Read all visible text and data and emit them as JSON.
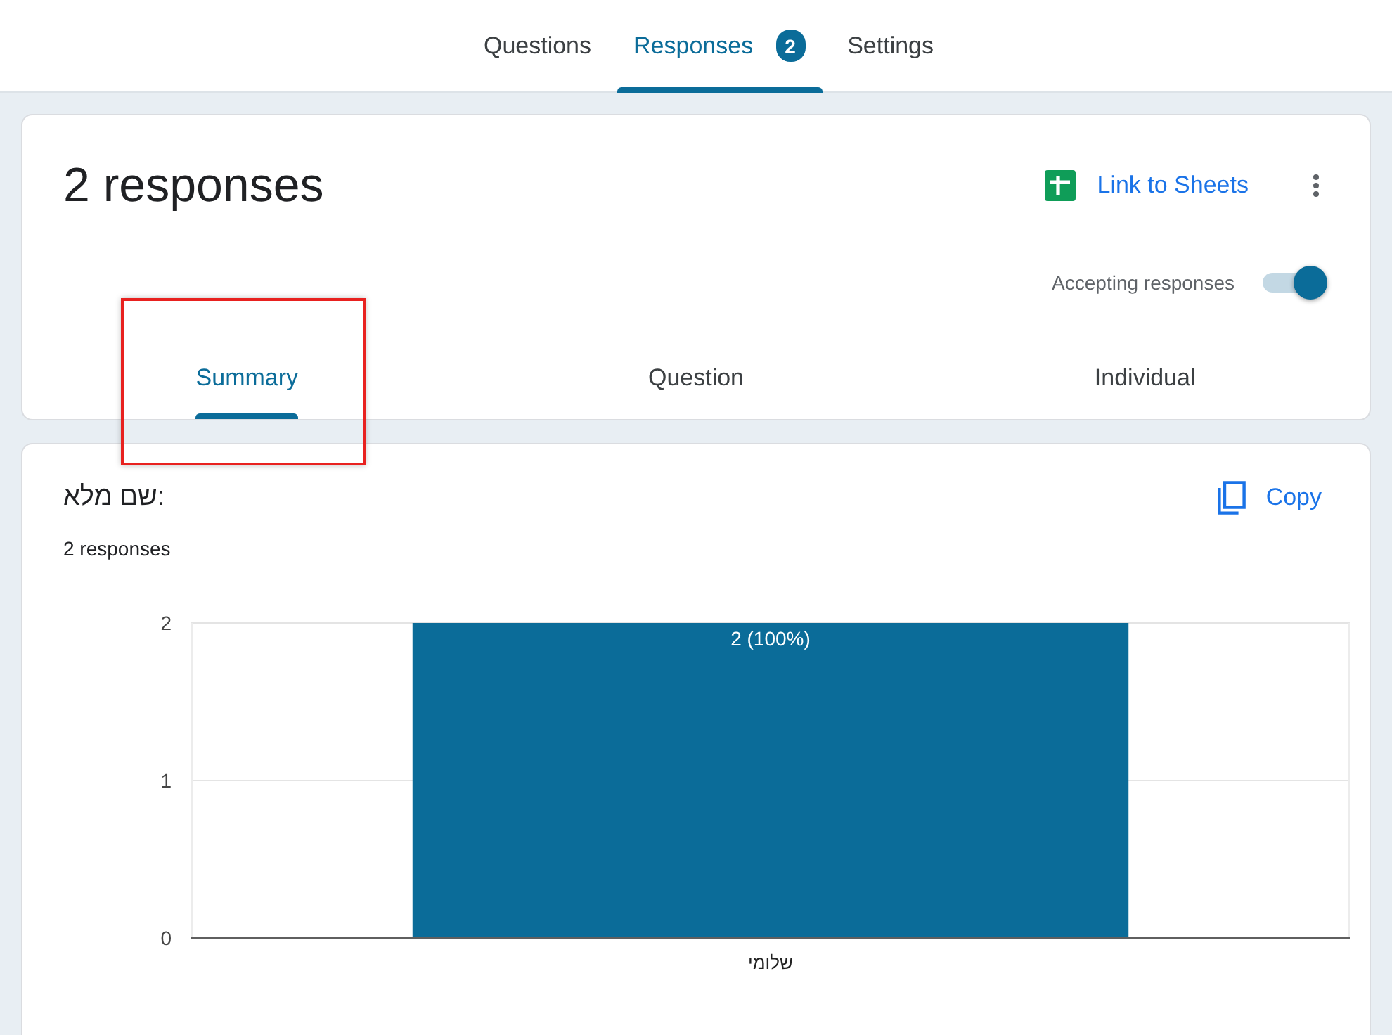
{
  "top_tabs": [
    {
      "label": "Questions",
      "selected": false
    },
    {
      "label": "Responses",
      "selected": true,
      "badge": "2"
    },
    {
      "label": "Settings",
      "selected": false
    }
  ],
  "summary_card": {
    "title": "2 responses",
    "link_button": {
      "label": "Link to Sheets"
    },
    "accepting": {
      "label": "Accepting responses",
      "on": true
    },
    "view_tabs": [
      {
        "label": "Summary",
        "selected": true
      },
      {
        "label": "Question",
        "selected": false
      },
      {
        "label": "Individual",
        "selected": false
      }
    ]
  },
  "annotation": {
    "kind": "rectangle"
  },
  "question_card": {
    "title": "שם מלא:",
    "count": "2 responses",
    "copy_button": {
      "label": "Copy"
    },
    "chart_data": {
      "type": "bar",
      "categories": [
        "שלומי"
      ],
      "values": [
        2
      ],
      "ylim": [
        0,
        2
      ],
      "yticks": [
        0,
        1,
        2
      ],
      "value_labels": [
        "2 (100%)"
      ]
    }
  }
}
